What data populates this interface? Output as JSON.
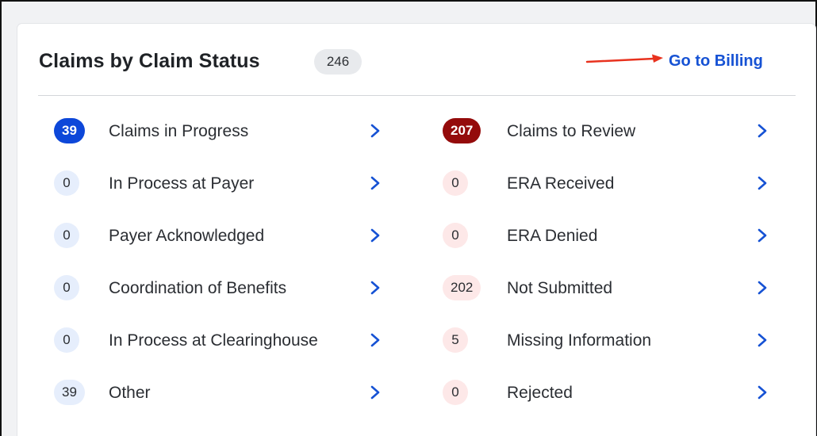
{
  "header": {
    "title": "Claims by Claim Status",
    "total": "246",
    "billing_link": "Go to Billing"
  },
  "colors": {
    "accent_blue": "#0d47d9",
    "link_blue": "#1652d4",
    "alert_red": "#940b0b",
    "annotation_arrow": "#e8321e"
  },
  "left_column": [
    {
      "count": "39",
      "label": "Claims in Progress"
    },
    {
      "count": "0",
      "label": "In Process at Payer"
    },
    {
      "count": "0",
      "label": "Payer Acknowledged"
    },
    {
      "count": "0",
      "label": "Coordination of Benefits"
    },
    {
      "count": "0",
      "label": "In Process at Clearinghouse"
    },
    {
      "count": "39",
      "label": "Other"
    }
  ],
  "right_column": [
    {
      "count": "207",
      "label": "Claims to Review"
    },
    {
      "count": "0",
      "label": "ERA Received"
    },
    {
      "count": "0",
      "label": "ERA Denied"
    },
    {
      "count": "202",
      "label": "Not Submitted"
    },
    {
      "count": "5",
      "label": "Missing Information"
    },
    {
      "count": "0",
      "label": "Rejected"
    }
  ],
  "icons": {
    "row_action": "chevron-right-icon",
    "annotation": "red-arrow-icon"
  }
}
